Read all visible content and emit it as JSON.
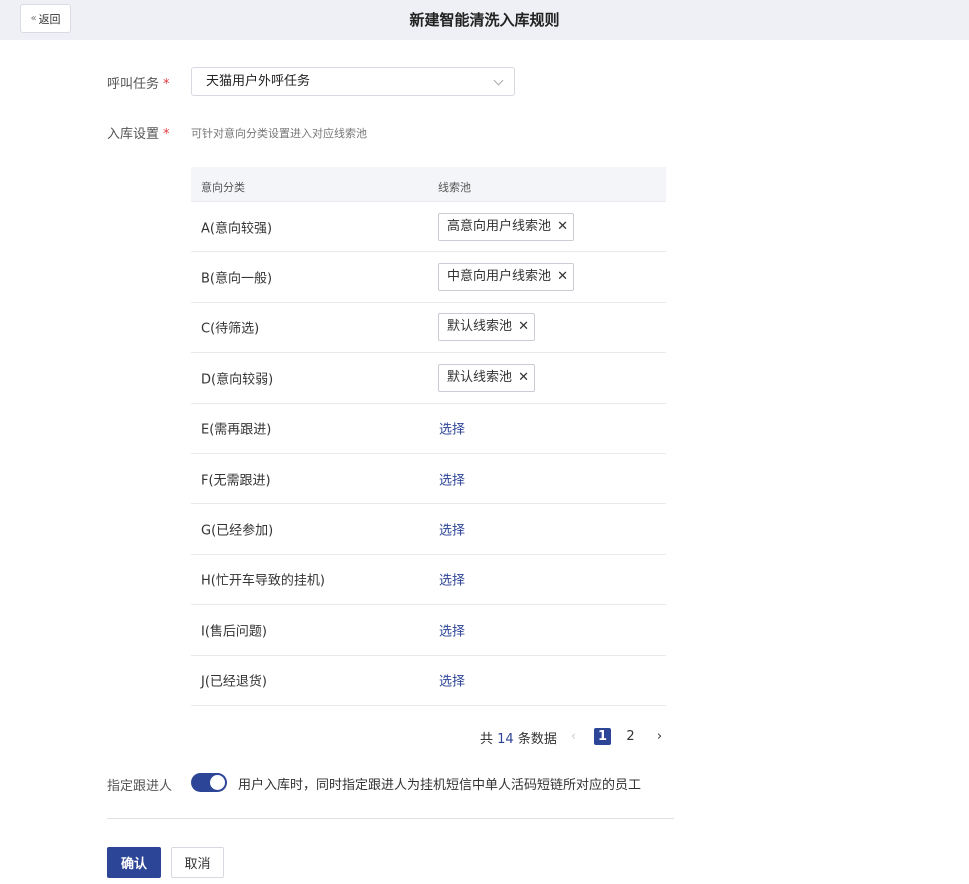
{
  "header": {
    "back_label": "返回",
    "title": "新建智能清洗入库规则"
  },
  "form": {
    "task_label": "呼叫任务",
    "task_value": "天猫用户外呼任务",
    "storage_label": "入库设置",
    "storage_hint": "可针对意向分类设置进入对应线索池",
    "required_mark": "*"
  },
  "table": {
    "col_category": "意向分类",
    "col_pool": "线索池",
    "pick_label": "选择",
    "rows": [
      {
        "category": "A(意向较强)",
        "pool": "高意向用户线索池"
      },
      {
        "category": "B(意向一般)",
        "pool": "中意向用户线索池"
      },
      {
        "category": "C(待筛选)",
        "pool": "默认线索池"
      },
      {
        "category": "D(意向较弱)",
        "pool": "默认线索池"
      },
      {
        "category": "E(需再跟进)",
        "pool": ""
      },
      {
        "category": "F(无需跟进)",
        "pool": ""
      },
      {
        "category": "G(已经参加)",
        "pool": ""
      },
      {
        "category": "H(忙开车导致的挂机)",
        "pool": ""
      },
      {
        "category": "I(售后问题)",
        "pool": ""
      },
      {
        "category": "J(已经退货)",
        "pool": ""
      }
    ]
  },
  "pagination": {
    "prefix": "共",
    "total": "14",
    "suffix": "条数据",
    "pages": [
      "1",
      "2"
    ],
    "current": "1"
  },
  "assign": {
    "label": "指定跟进人",
    "enabled": true,
    "text": "用户入库时，同时指定跟进人为挂机短信中单人活码短链所对应的员工"
  },
  "actions": {
    "confirm_label": "确认",
    "cancel_label": "取消"
  },
  "colors": {
    "primary": "#2d4597",
    "required": "#e0393e"
  }
}
